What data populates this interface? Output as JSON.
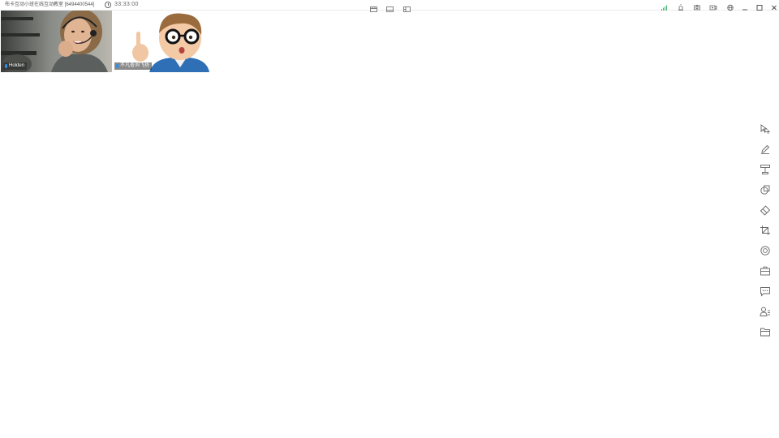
{
  "window": {
    "title": "布卡互动小班在线互动教室 [6494400544]",
    "timer": "33:33:00"
  },
  "participants": [
    {
      "name": "Holden"
    },
    {
      "name": "不凡查询飞扬"
    }
  ],
  "colors": {
    "signal": "#3cb371",
    "mic": "#2a8ff0",
    "icon": "#666666"
  },
  "layout_buttons": [
    "layout-grid-icon",
    "layout-bottom-strip-icon",
    "layout-side-strip-icon"
  ],
  "status_icons": [
    "signal-strength-icon",
    "alarm-icon",
    "camera-icon",
    "record-icon",
    "globe-icon"
  ],
  "window_controls": [
    "minimize-icon",
    "maximize-icon",
    "close-icon"
  ],
  "toolbar": [
    "select-move-tool-icon",
    "pen-tool-icon",
    "text-tool-icon",
    "shape-tool-icon",
    "eraser-tool-icon",
    "crop-tool-icon",
    "target-tool-icon",
    "toolbox-icon",
    "chat-icon",
    "user-list-icon",
    "folder-icon"
  ]
}
